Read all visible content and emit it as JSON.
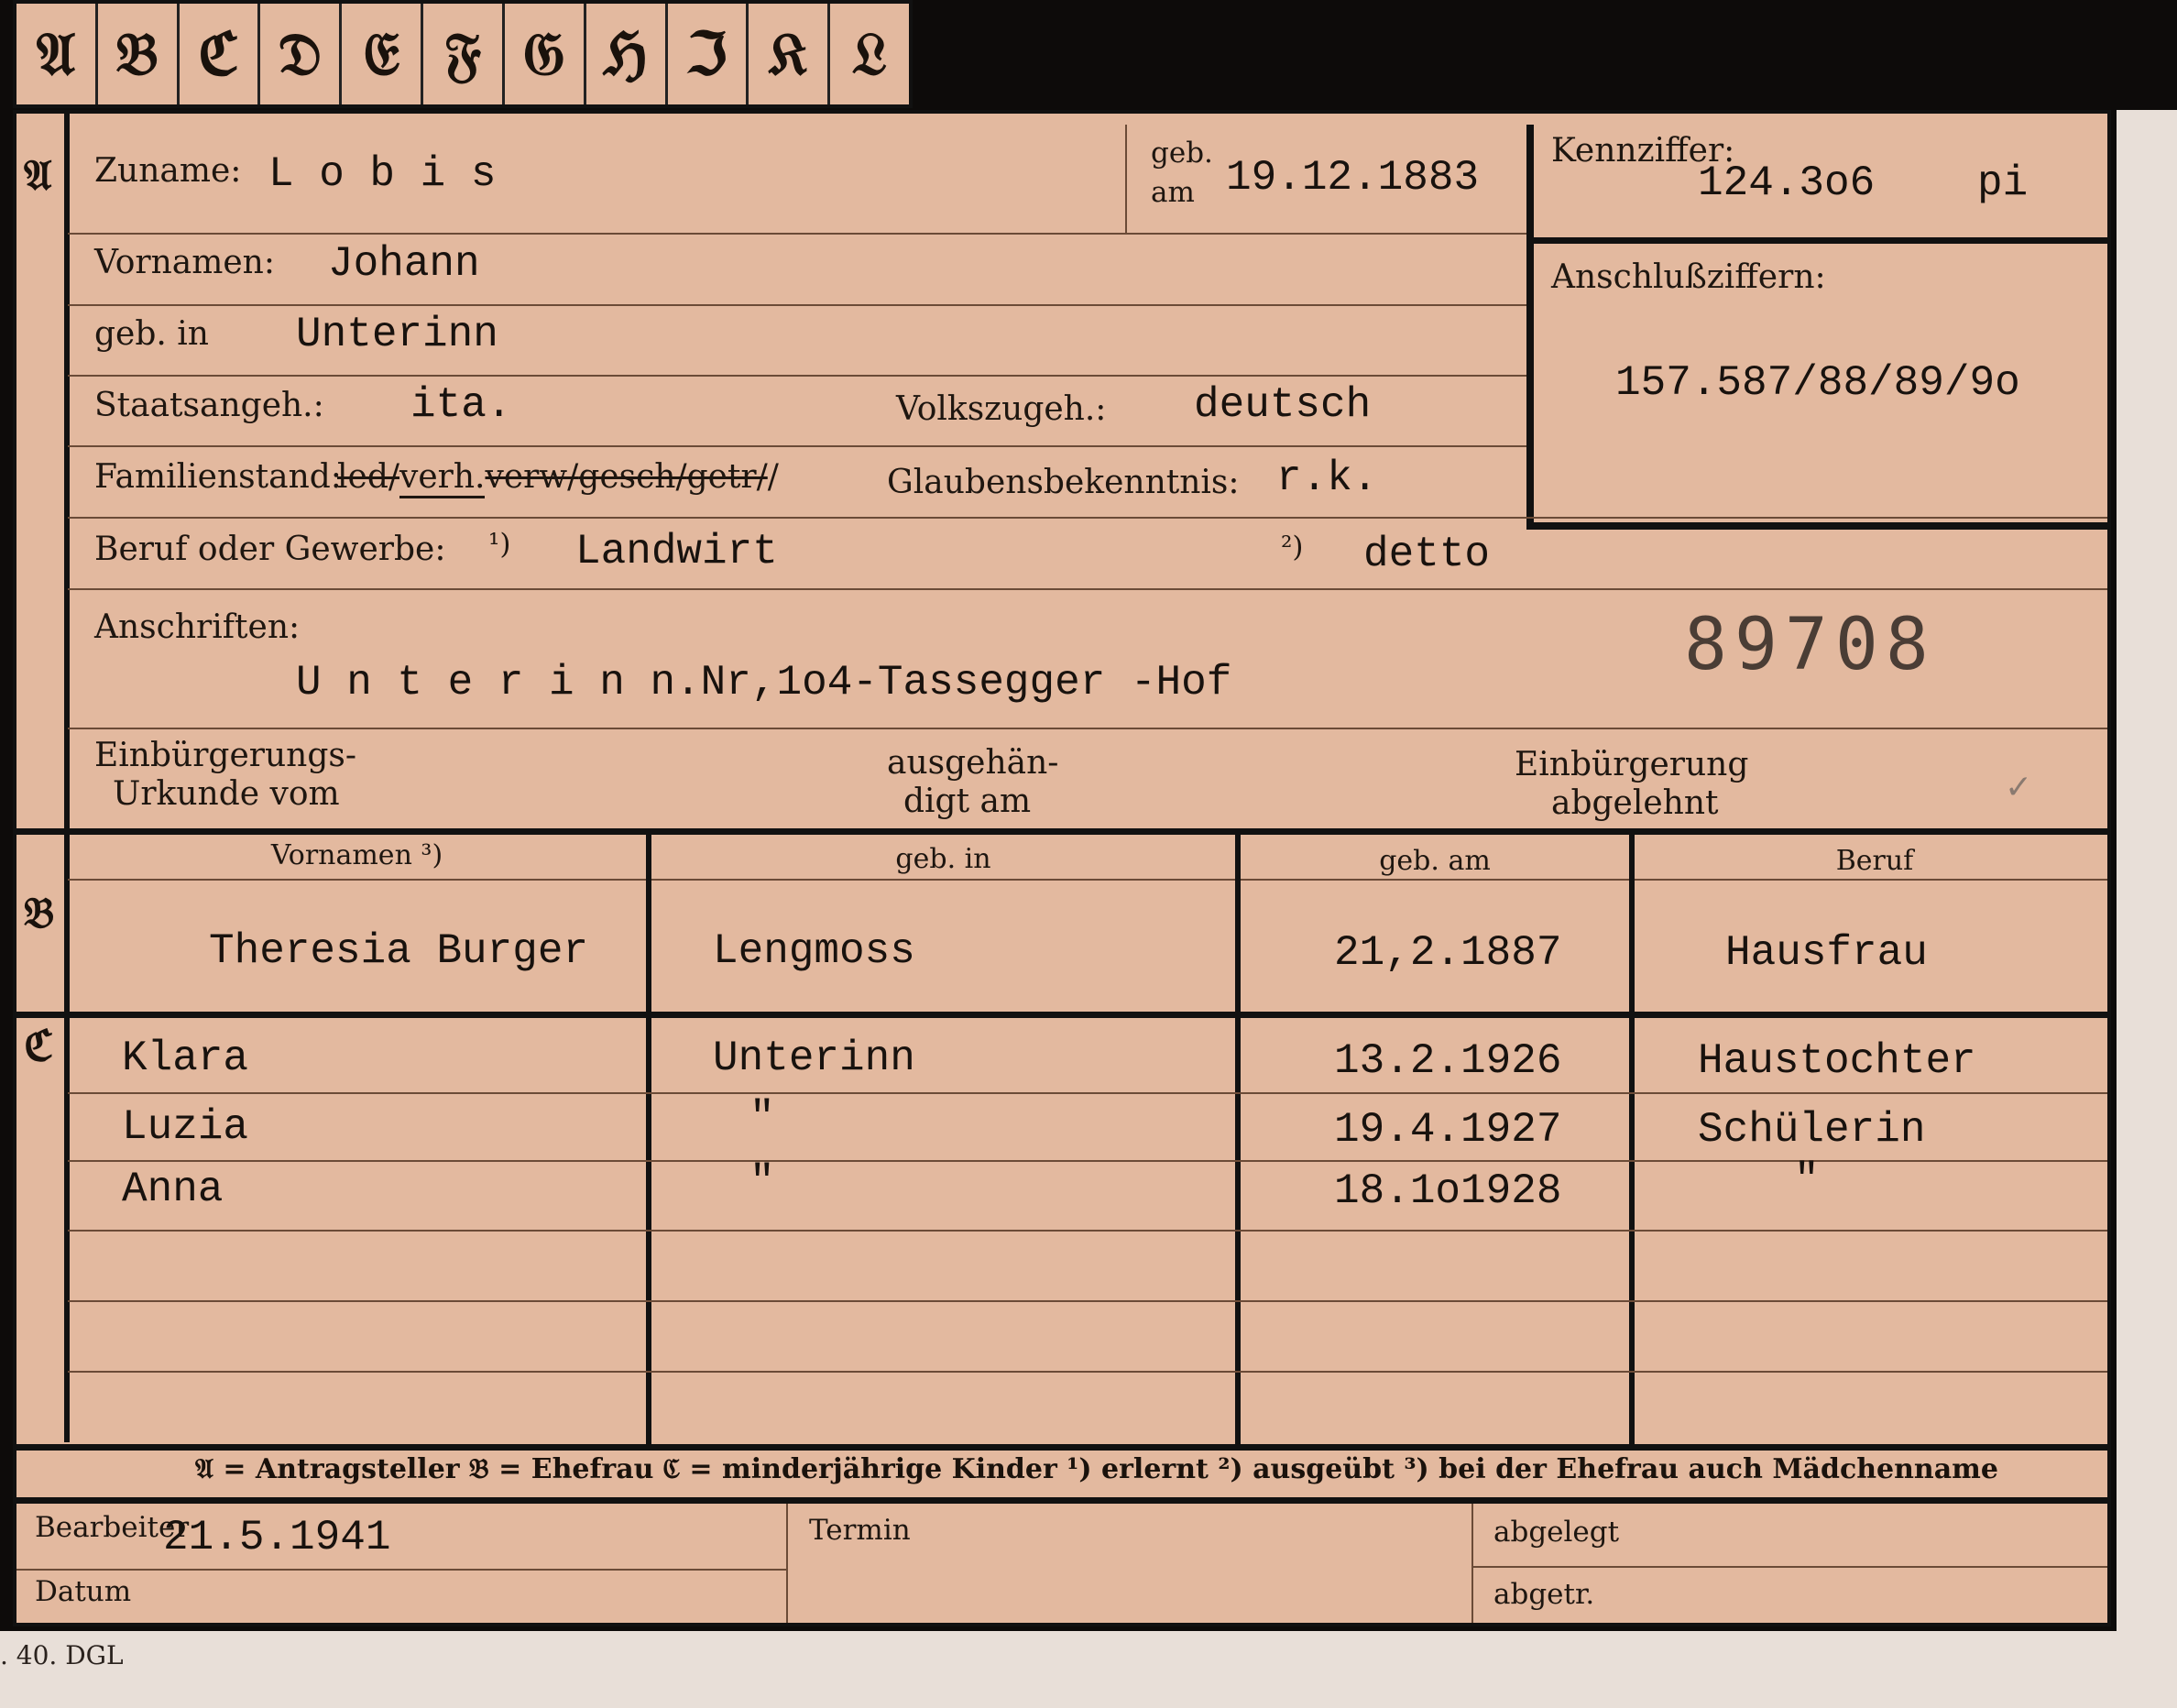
{
  "index_tabs": [
    "𝔄",
    "𝔅",
    "ℭ",
    "𝔇",
    "𝔈",
    "𝔉",
    "𝔊",
    "ℌ",
    "ℑ",
    "𝔎",
    "𝔏"
  ],
  "section_letters": {
    "a": "𝔄",
    "b": "𝔅",
    "c": "ℭ"
  },
  "applicant": {
    "surname_label": "Zuname:",
    "surname": "L o b i s",
    "born_on_label_1": "geb.",
    "born_on_label_2": "am",
    "born_on": "19.12.1883",
    "first_names_label": "Vornamen:",
    "first_names": "Johann",
    "born_in_label": "geb. in",
    "born_in": "Unterinn",
    "citizenship_label": "Staatsangeh.:",
    "citizenship": "ita.",
    "ethnicity_label": "Volkszugeh.:",
    "ethnicity": "deutsch",
    "marital_status_label": "Familienstand:",
    "marital_status_options": [
      "led/",
      "verh.",
      "verw/",
      "gesch/",
      "getr/",
      "/"
    ],
    "religion_label": "Glaubensbekenntnis:",
    "religion": "r.k.",
    "occupation_label": "Beruf oder Gewerbe:",
    "occupation_mark_1": "¹)",
    "occupation_learned": "Landwirt",
    "occupation_mark_2": "²)",
    "occupation_practiced": "detto",
    "addresses_label": "Anschriften:",
    "address": "U n t e r i n n.Nr,1o4-Tassegger -Hof",
    "stamp_number": "89708",
    "naturalization_cert_label_1": "Einbürgerungs-",
    "naturalization_cert_label_2": "Urkunde vom",
    "handed_out_label_1": "ausgehän-",
    "handed_out_label_2": "digt am",
    "naturalization_refused_label_1": "Einbürgerung",
    "naturalization_refused_label_2": "abgelehnt",
    "checkmark": "✓"
  },
  "reference": {
    "id_label": "Kennziffer:",
    "id_number": "124.3o6",
    "id_suffix": "pi",
    "linked_label": "Anschlußziffern:",
    "linked_numbers": "157.587/88/89/9o"
  },
  "spouse": {
    "headers": [
      "Vornamen ³)",
      "geb. in",
      "geb. am",
      "Beruf"
    ],
    "name": "Theresia Burger",
    "born_in": "Lengmoss",
    "born_on": "21,2.1887",
    "occupation": "Hausfrau"
  },
  "children": [
    {
      "name": "Klara",
      "born_in": "Unterinn",
      "born_on": "13.2.1926",
      "occupation": "Haustochter"
    },
    {
      "name": "Luzia",
      "born_in": "\"",
      "born_on": "19.4.1927",
      "occupation": "Schülerin"
    },
    {
      "name": "Anna",
      "born_in": "\"",
      "born_on": "18.1o1928",
      "occupation": "\""
    }
  ],
  "legend": "𝔄 = Antragsteller   𝔅 = Ehefrau   ℭ = minderjährige Kinder   ¹) erlernt   ²) ausgeübt   ³) bei der Ehefrau auch Mädchenname",
  "footer": {
    "processor_label": "Bearbeiter",
    "date_label": "Datum",
    "date_value": "21.5.1941",
    "deadline_label": "Termin",
    "filed_label": "abgelegt",
    "removed_label": "abgetr.",
    "form_code": ". 40. DGL"
  }
}
